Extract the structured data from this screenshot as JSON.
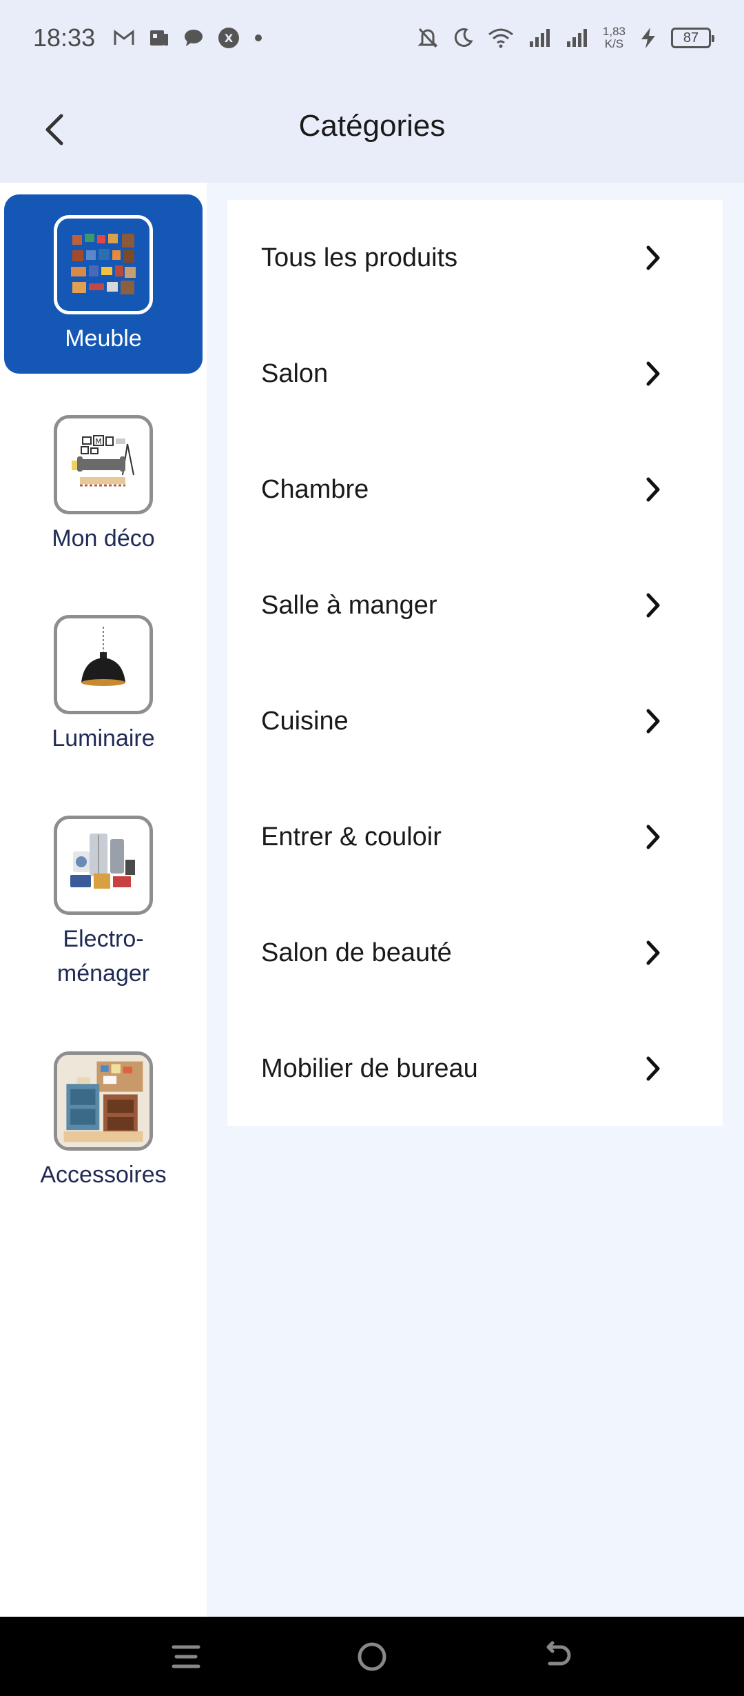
{
  "status_bar": {
    "time": "18:33",
    "speed_value": "1,83",
    "speed_unit": "K/S",
    "battery": "87",
    "icons": [
      "gmail-icon",
      "news-icon",
      "chat-bubble-icon",
      "app-x-icon",
      "dot-icon",
      "bell-off-icon",
      "moon-icon",
      "wifi-icon",
      "signal-icon",
      "signal-icon",
      "charging-icon"
    ]
  },
  "header": {
    "title": "Catégories",
    "back_icon": "chevron-left-icon"
  },
  "sidebar": {
    "items": [
      {
        "label": "Meuble",
        "active": true
      },
      {
        "label": "Mon déco",
        "active": false
      },
      {
        "label": "Luminaire",
        "active": false
      },
      {
        "label_line1": "Electro-",
        "label_line2": "ménager",
        "active": false
      },
      {
        "label": "Accessoires",
        "active": false
      }
    ]
  },
  "subcategories": [
    {
      "label": "Tous les produits"
    },
    {
      "label": "Salon"
    },
    {
      "label": "Chambre"
    },
    {
      "label": "Salle à manger"
    },
    {
      "label": "Cuisine"
    },
    {
      "label": "Entrer & couloir"
    },
    {
      "label": "Salon de beauté"
    },
    {
      "label": "Mobilier de bureau"
    }
  ],
  "colors": {
    "accent": "#1557b5",
    "header_bg": "#e8edf9",
    "page_bg": "#f1f5fd",
    "nav_bg": "#000000"
  },
  "nav_bar": {
    "icons": [
      "menu-icon",
      "home-icon",
      "back-icon"
    ]
  }
}
